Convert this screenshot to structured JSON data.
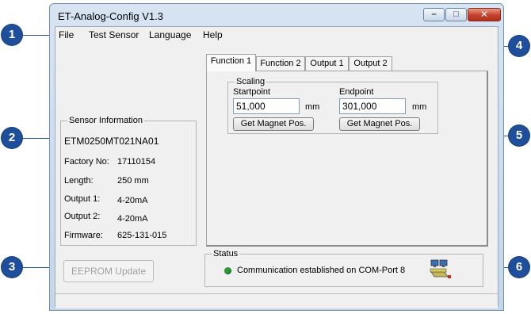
{
  "window": {
    "title": "ET-Analog-Config V1.3",
    "min_glyph": "–",
    "max_glyph": "□",
    "close_glyph": "✕"
  },
  "menu": [
    "File",
    "Test Sensor",
    "Language",
    "Help"
  ],
  "tabs": [
    "Function 1",
    "Function 2",
    "Output 1",
    "Output 2"
  ],
  "scaling": {
    "legend": "Scaling",
    "start_label": "Startpoint",
    "start_value": "51,000",
    "end_label": "Endpoint",
    "end_value": "301,000",
    "unit": "mm",
    "get_pos_label": "Get Magnet Pos."
  },
  "sensor_info": {
    "legend": "Sensor Information",
    "model": "ETM0250MT021NA01",
    "rows": [
      {
        "label": "Factory No:",
        "value": "17110154"
      },
      {
        "label": "Length:",
        "value": "250 mm"
      },
      {
        "label": "Output 1:",
        "value": "4-20mA"
      },
      {
        "label": "Output 2:",
        "value": "4-20mA"
      },
      {
        "label": "Firmware:",
        "value": "625-131-015"
      }
    ]
  },
  "eeprom_button": "EEPROM Update",
  "status": {
    "legend": "Status",
    "message": "Communication established on COM-Port 8",
    "led_color": "#2e9a3a"
  },
  "callouts": [
    "1",
    "2",
    "3",
    "4",
    "5",
    "6"
  ],
  "icons": {
    "network": "network-computers-icon"
  }
}
